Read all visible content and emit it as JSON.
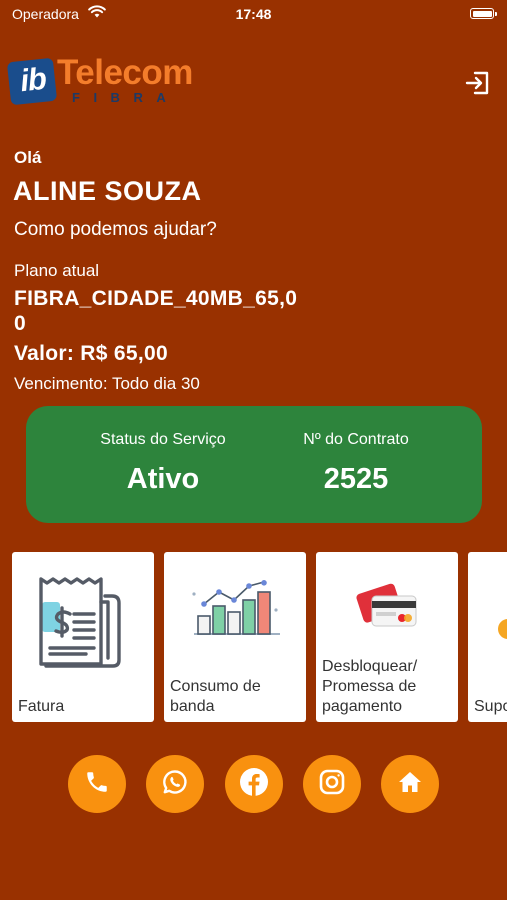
{
  "status_bar": {
    "carrier": "Operadora",
    "time": "17:48"
  },
  "header": {
    "logo_ib": "ib",
    "logo_telecom": "Telecom",
    "logo_fibra": "FIBRA"
  },
  "greeting": {
    "hello": "Olá",
    "name": "ALINE SOUZA",
    "help": "Como podemos ajudar?"
  },
  "plan": {
    "label": "Plano atual",
    "name": "FIBRA_CIDADE_40MB_65,00",
    "value": "Valor: R$ 65,00",
    "due": "Vencimento: Todo dia 30"
  },
  "status_card": {
    "service_label": "Status do Serviço",
    "service_value": "Ativo",
    "contract_label": "Nº do Contrato",
    "contract_value": "2525"
  },
  "tiles": [
    {
      "label": "Fatura",
      "icon": "invoice-icon"
    },
    {
      "label": "Consumo de banda",
      "icon": "bar-chart-icon"
    },
    {
      "label": "Desbloquear/ Promessa de pagamento",
      "icon": "credit-card-icon"
    },
    {
      "label": "Suporte",
      "icon": "support-icon"
    }
  ],
  "bottom_actions": [
    {
      "icon": "phone-icon"
    },
    {
      "icon": "whatsapp-icon"
    },
    {
      "icon": "facebook-icon"
    },
    {
      "icon": "instagram-icon"
    },
    {
      "icon": "home-icon"
    }
  ],
  "colors": {
    "background": "#993100",
    "status_card": "#2d843c",
    "action_button": "#f9910f",
    "logo_orange": "#f47d2b",
    "logo_blue": "#1a4d8c"
  }
}
